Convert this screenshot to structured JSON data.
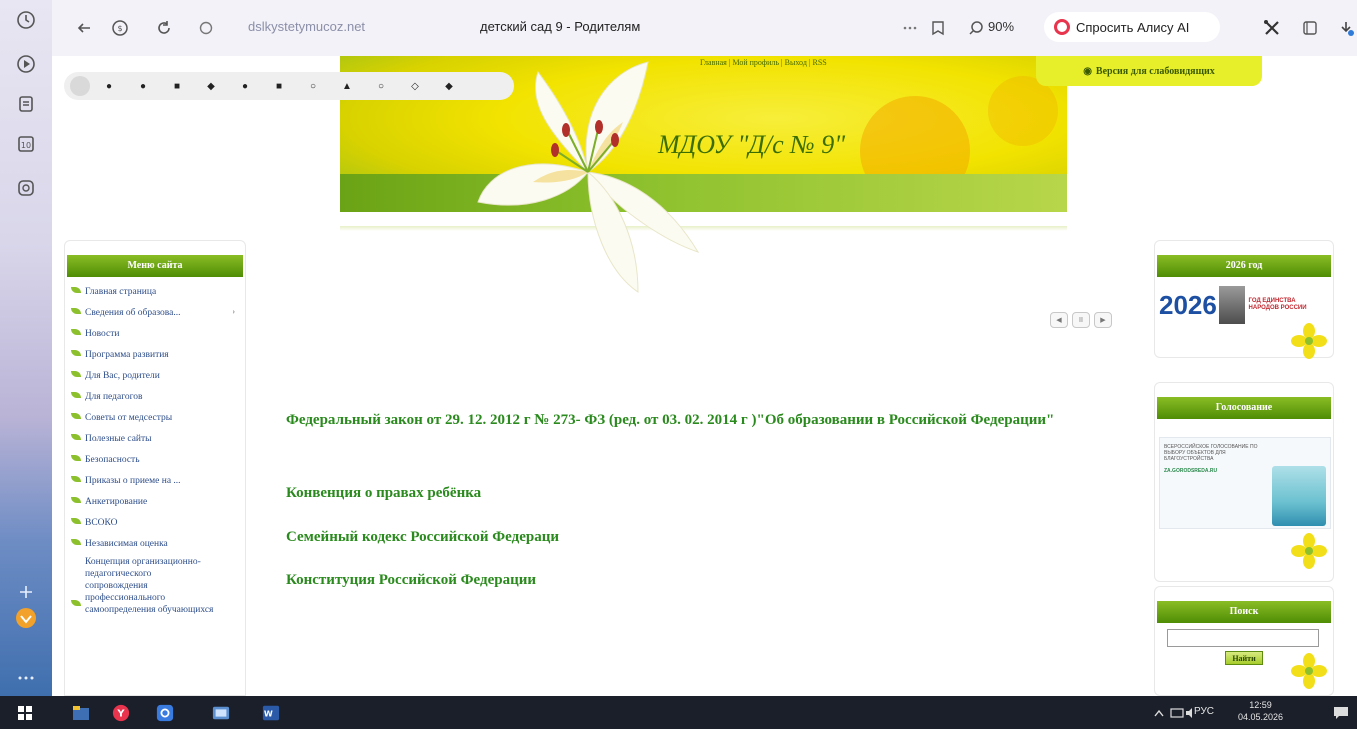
{
  "browser": {
    "address_domain": "dslkystetymucoz.net",
    "page_title": "детский сад 9 - Родителям",
    "zoom_label": "90%",
    "alice_label": "Спросить Алису AI"
  },
  "site": {
    "header_links": "Главная | Мой профиль | Выход | RSS",
    "title": "МДОУ \"Д/с № 9\"",
    "low_vision_label": "Версия для слабовидящих"
  },
  "left_menu": {
    "heading": "Меню сайта",
    "items": [
      {
        "label": "Главная страница"
      },
      {
        "label": "Сведения об образова..."
      },
      {
        "label": "Новости"
      },
      {
        "label": "Программа развития"
      },
      {
        "label": "Для Вас, родители"
      },
      {
        "label": "Для педагогов"
      },
      {
        "label": "Советы от медсестры"
      },
      {
        "label": "Полезные сайты"
      },
      {
        "label": "Безопасность"
      },
      {
        "label": "Приказы о приеме на ..."
      },
      {
        "label": "Анкетирование"
      },
      {
        "label": "ВСОКО"
      },
      {
        "label": "Независимая оценка"
      },
      {
        "label": "Концепция организационно-педагогического сопровождения профессионального самоопределения обучающихся"
      }
    ]
  },
  "main": {
    "links": [
      "Федеральный закон от 29. 12. 2012 г № 273- ФЗ (ред. от 03. 02. 2014 г )\"Об образовании в Российской Федерации\"",
      "Конвенция о правах ребёнка",
      "Семейный кодекс Российской Федераци",
      "Конституция Российской Федерации"
    ]
  },
  "right": {
    "year_box": {
      "heading": "2026 год",
      "year": "2026",
      "caption": "ГОД ЕДИНСТВА НАРОДОВ РОССИИ"
    },
    "vote_box": {
      "heading": "Голосование",
      "card_title": "ВСЕРОССИЙСКОЕ ГОЛОСОВАНИЕ ПО ВЫБОРУ ОБЪЕКТОВ ДЛЯ БЛАГОУСТРОЙСТВА",
      "card_link": "ZA.GORODSREDA.RU"
    },
    "search_box": {
      "heading": "Поиск",
      "button_label": "Найти"
    }
  },
  "taskbar": {
    "language": "РУС",
    "time": "12:59",
    "date": "04.05.2026"
  },
  "colors": {
    "brand_green": "#4f8d05",
    "link_green": "#2a8a1d",
    "menu_link": "#2e4e8a",
    "banner_yellow": "#f2e300",
    "low_vision_bg": "#e7ef2a"
  }
}
